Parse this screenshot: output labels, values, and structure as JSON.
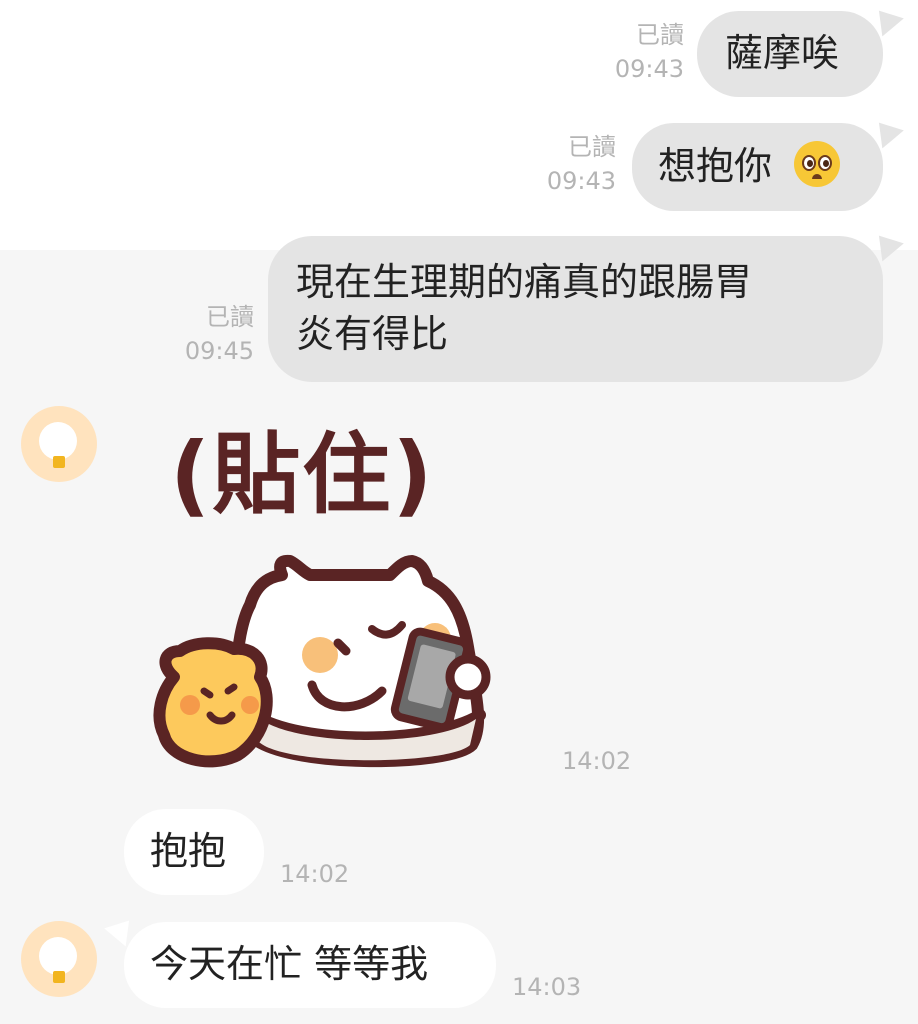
{
  "chat": {
    "messages": [
      {
        "direction": "out",
        "text": "薩摩唉",
        "read": "已讀",
        "time": "09:43"
      },
      {
        "direction": "out",
        "text": "想抱你",
        "emoji": "pleading-face",
        "read": "已讀",
        "time": "09:43"
      },
      {
        "direction": "out",
        "lines": [
          "現在生理期的痛真的跟腸胃",
          "炎有得比"
        ],
        "read": "已讀",
        "time": "09:45"
      },
      {
        "direction": "in",
        "type": "sticker",
        "caption": "(貼住)",
        "time": "14:02"
      },
      {
        "direction": "in",
        "text": "抱抱",
        "time": "14:02"
      },
      {
        "direction": "in",
        "text": "今天在忙 等等我",
        "time": "14:03"
      }
    ]
  },
  "colors": {
    "outgoing_bubble": "#e4e4e4",
    "incoming_bubble": "#ffffff",
    "background": "#f6f6f6",
    "meta_text": "#b4b4b4",
    "avatar": "#ffe3be",
    "sticker_ink": "#5a2424"
  }
}
